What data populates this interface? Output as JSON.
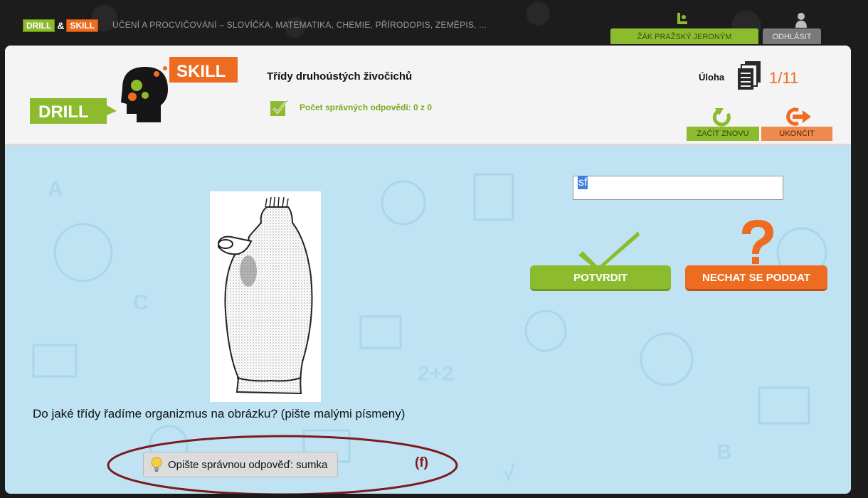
{
  "topbar": {
    "brand_drill": "DRILL",
    "brand_amp": "&",
    "brand_skill": "SKILL",
    "tagline": "UČENÍ A PROCVIČOVÁNÍ – SLOVÍČKA, MATEMATIKA, CHEMIE, PŘÍRODOPIS, ZEMĚPIS, ...",
    "user_label": "ŽÁK PRAŽSKÝ JERONÝM",
    "logout_label": "ODHLÁSIT"
  },
  "header": {
    "logo_drill": "DRILL",
    "logo_skill": "SKILL",
    "task_title": "Třídy druhoústých živočichů",
    "correct_count": "Počet správných odpovědí: 0 z 0",
    "task_label": "Úloha",
    "task_counter": "1/11",
    "restart_label": "ZAČÍT ZNOVU",
    "quit_label": "UKONČIT"
  },
  "exercise": {
    "answer_value": "sf",
    "confirm_label": "POTVRDIT",
    "giveup_label": "NECHAT SE PODDAT",
    "question": "Do jaké třídy řadíme organizmus na obrázku? (pište malými písmeny)",
    "hint_label": "Opište správnou odpověď: sumka",
    "annotation_mark": "(f)"
  },
  "colors": {
    "accent_green": "#8dbb2e",
    "accent_orange": "#ee6b22",
    "content_bg": "#bfe3f2",
    "annotation": "#7b1a20"
  }
}
